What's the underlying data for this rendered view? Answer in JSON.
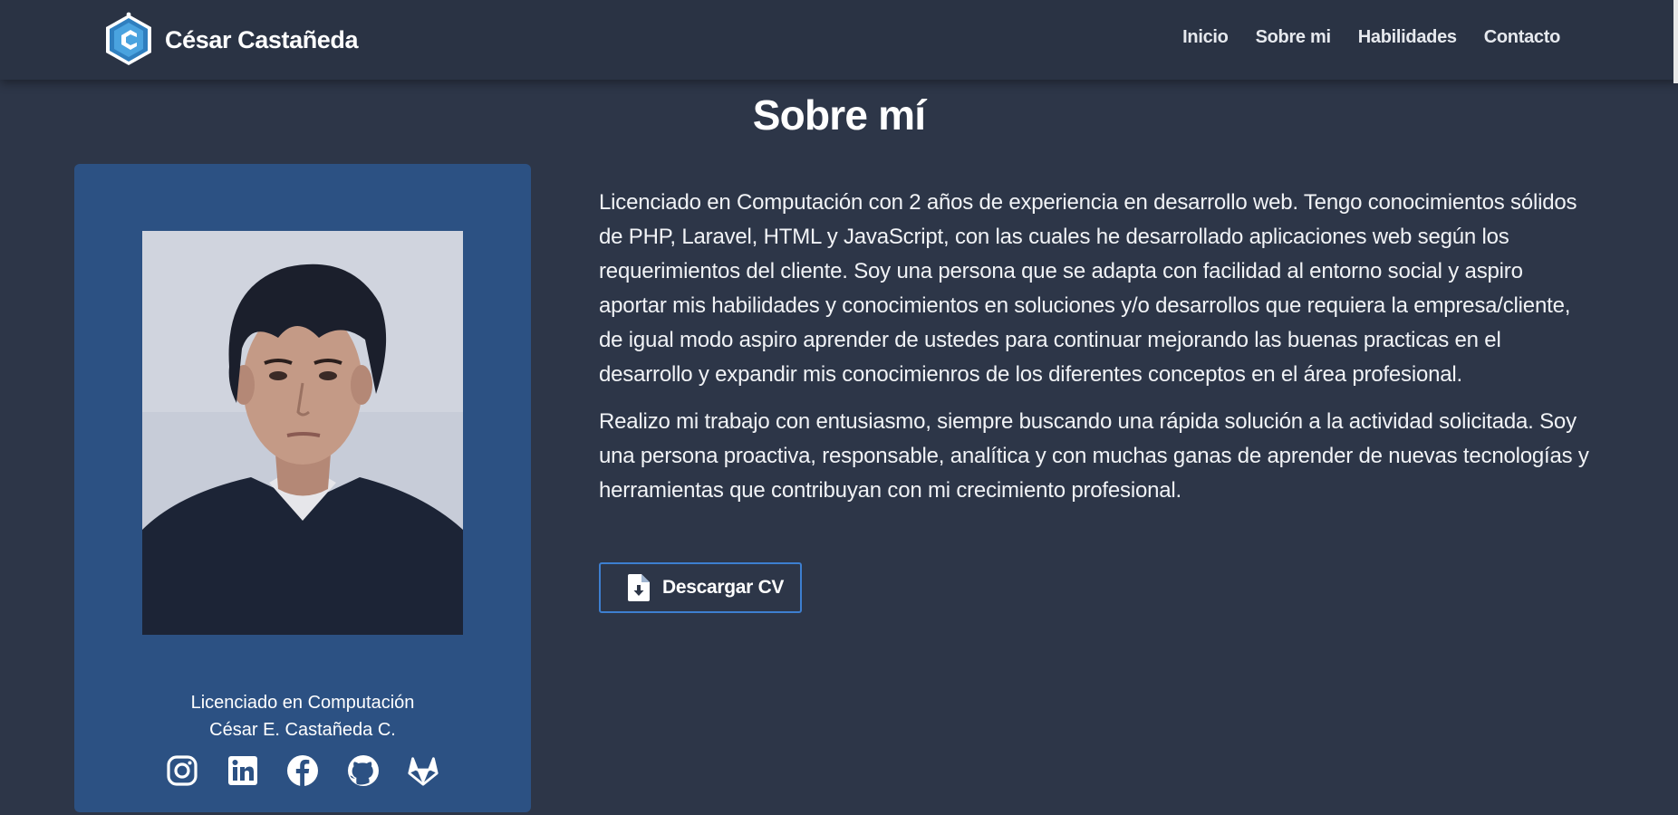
{
  "navbar": {
    "brand_name": "César Castañeda",
    "logo_icon": "hexagon-c-logo",
    "links": [
      {
        "label": "Inicio"
      },
      {
        "label": "Sobre mi"
      },
      {
        "label": "Habilidades"
      },
      {
        "label": "Contacto"
      }
    ]
  },
  "section": {
    "title": "Sobre mí"
  },
  "profile": {
    "photo": "portrait-photo",
    "degree": "Licenciado en Computación",
    "name": "César E. Castañeda C.",
    "socials": [
      {
        "icon": "instagram-icon"
      },
      {
        "icon": "linkedin-icon"
      },
      {
        "icon": "facebook-icon"
      },
      {
        "icon": "github-icon"
      },
      {
        "icon": "gitlab-icon"
      }
    ]
  },
  "about": {
    "paragraphs": [
      "Licenciado en Computación con 2 años de experiencia en desarrollo web. Tengo conocimientos sólidos de PHP, Laravel, HTML y JavaScript, con las cuales he desarrollado aplicaciones web según los requerimientos del cliente. Soy una persona que se adapta con facilidad al entorno social y aspiro aportar mis habilidades y conocimientos en soluciones y/o desarrollos que requiera la empresa/cliente, de igual modo aspiro aprender de ustedes para continuar mejorando las buenas practicas en el desarrollo y expandir mis conocimienros de los diferentes conceptos en el área profesional.",
      "Realizo mi trabajo con entusiasmo, siempre buscando una rápida solución a la actividad solicitada. Soy una persona proactiva, responsable, analítica y con muchas ganas de aprender de nuevas tecnologías y herramientas que contribuyan con mi crecimiento profesional."
    ],
    "download_button": {
      "label": "Descargar CV",
      "icon": "file-download-icon"
    }
  },
  "colors": {
    "background": "#2d3648",
    "navbar": "#2a3344",
    "card": "#2c5183",
    "button_border": "#3d7fd0",
    "logo": "#4aa3df"
  }
}
